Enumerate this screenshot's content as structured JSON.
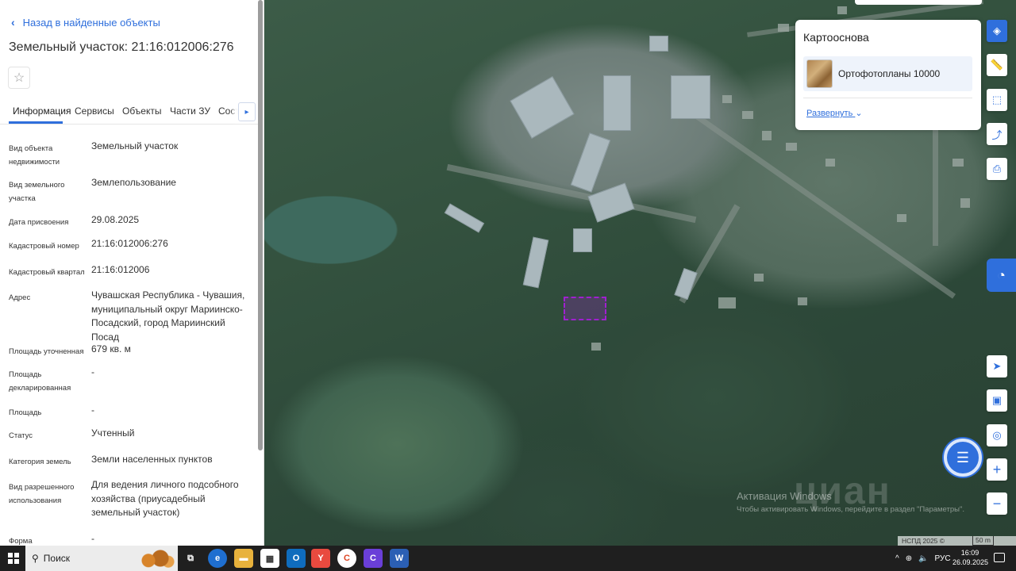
{
  "panel": {
    "back_label": "Назад в найденные объекты",
    "title": "Земельный участок: 21:16:012006:276",
    "tabs": [
      "Информация",
      "Сервисы",
      "Объекты",
      "Части ЗУ",
      "Соста"
    ],
    "active_tab": "Информация",
    "rows": [
      {
        "label": "Вид объекта недвижимости",
        "value": "Земельный участок"
      },
      {
        "label": "Вид земельного участка",
        "value": "Землепользование"
      },
      {
        "label": "Дата присвоения",
        "value": "29.08.2025"
      },
      {
        "label": "Кадастровый номер",
        "value": "21:16:012006:276"
      },
      {
        "label": "Кадастровый квартал",
        "value": "21:16:012006"
      },
      {
        "label": "Адрес",
        "value": "Чувашская Республика - Чувашия, муниципальный округ Мариинско-Посадский, город Мариинский Посад"
      },
      {
        "label": "Площадь уточненная",
        "value": "679 кв. м"
      },
      {
        "label": "Площадь декларированная",
        "value": "-"
      },
      {
        "label": "Площадь",
        "value": "-"
      },
      {
        "label": "Статус",
        "value": "Учтенный"
      },
      {
        "label": "Категория земель",
        "value": "Земли населенных пунктов"
      },
      {
        "label": "Вид разрешенного использования",
        "value": "Для ведения личного подсобного хозяйства (приусадебный земельный участок)"
      },
      {
        "label": "Форма собственности",
        "value": "-"
      }
    ]
  },
  "basemap": {
    "title": "Картооснова",
    "layer_name": "Ортофотопланы 10000",
    "expand_label": "Развернуть"
  },
  "map": {
    "watermark_line1": "Активация Windows",
    "watermark_line2": "Чтобы активировать Windows, перейдите в раздел \"Параметры\".",
    "attribution": "НСПД 2025 ©",
    "scale_label": "50 m",
    "brand_watermark": "циан"
  },
  "taskbar": {
    "search_label": "Поиск",
    "language": "РУС",
    "time": "16:09",
    "date": "26.09.2025"
  },
  "colors": {
    "accent": "#2f6fdc",
    "parcel": "#a020d0"
  }
}
